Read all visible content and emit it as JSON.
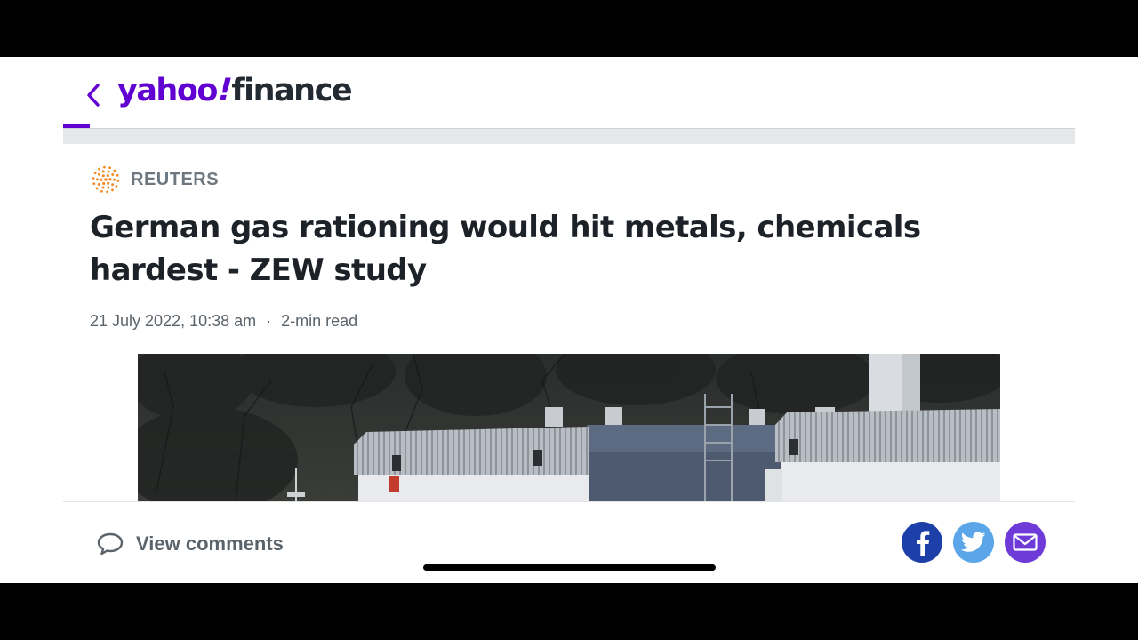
{
  "header": {
    "logo_text_yahoo": "yahoo",
    "logo_text_bang": "!",
    "logo_text_finance": "finance",
    "back_icon": "chevron-left-icon"
  },
  "article": {
    "provider": "REUTERS",
    "provider_icon": "reuters-logo",
    "headline": "German gas rationing would hit metals, chemicals hardest - ZEW study",
    "date": "21 July 2022, 10:38 am",
    "separator": "·",
    "read_time": "2-min read"
  },
  "footer": {
    "comments_label": "View comments",
    "share_icons": [
      "facebook-icon",
      "twitter-icon",
      "email-icon"
    ]
  },
  "colors": {
    "brand": "#6001d2",
    "headline": "#1d2228",
    "meta": "#5b636a",
    "facebook": "#1d3fa8",
    "twitter": "#5aa6e8",
    "email": "#6e3bd8"
  }
}
